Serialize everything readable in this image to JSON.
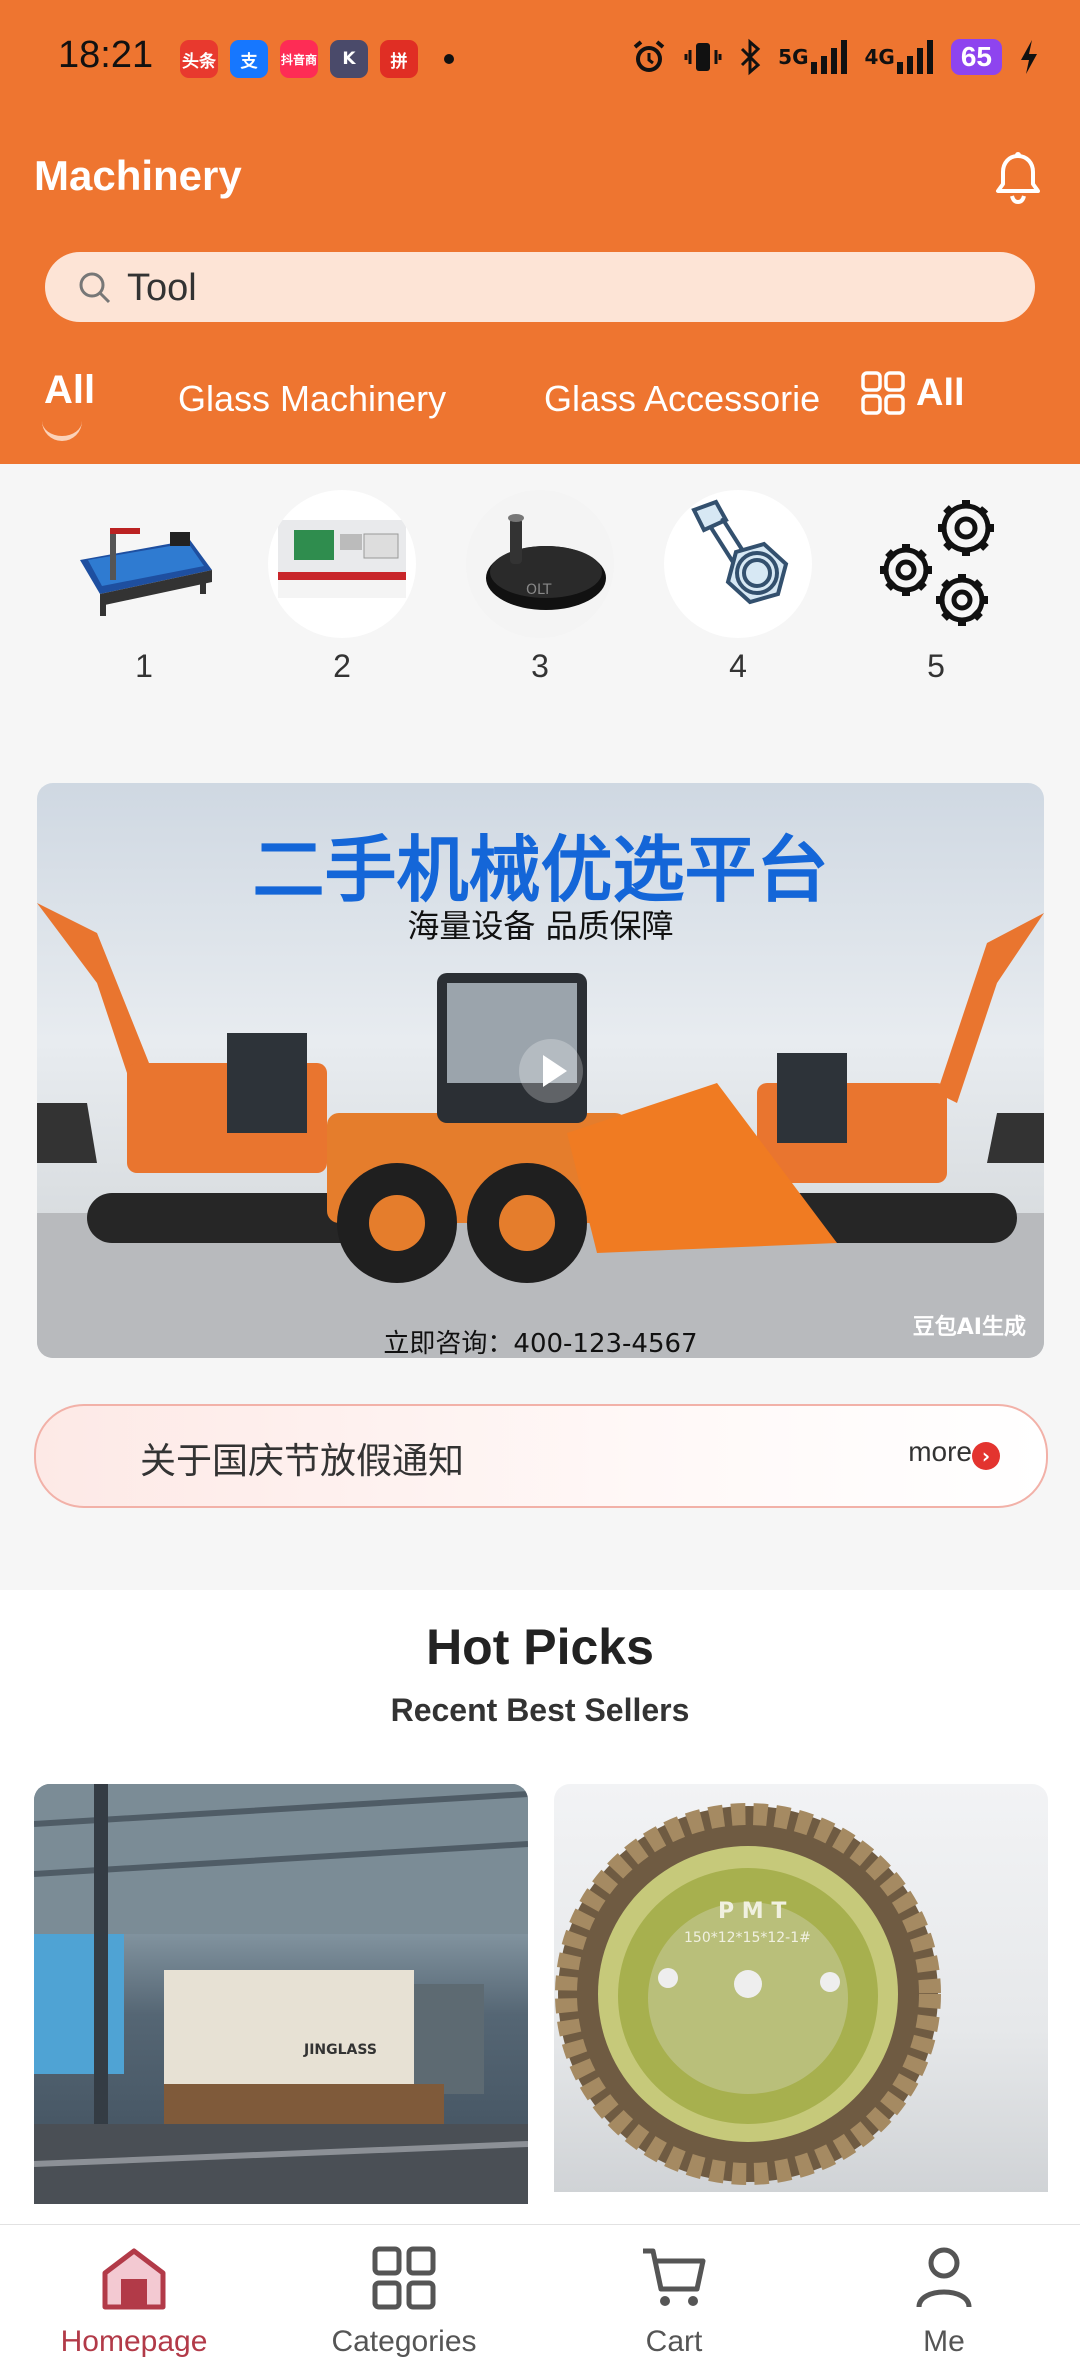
{
  "status_bar": {
    "time": "18:21",
    "app_icons": [
      {
        "name": "toutiao-app-icon",
        "label": "头条",
        "color": "#e8392e"
      },
      {
        "name": "alipay-app-icon",
        "label": "支",
        "color": "#1677ff"
      },
      {
        "name": "douyin-mall-app-icon",
        "label": "抖音商",
        "color": "#fe2c55"
      },
      {
        "name": "k-app-icon",
        "label": "K",
        "color": "#4a4a6a"
      },
      {
        "name": "pinduoduo-app-icon",
        "label": "拼",
        "color": "#e02e24"
      }
    ],
    "network": "5G",
    "network2": "4G",
    "battery": "65"
  },
  "header": {
    "title": "Machinery"
  },
  "search": {
    "value": "Tool"
  },
  "tabs": [
    {
      "label": "All",
      "active": true
    },
    {
      "label": "Glass Machinery",
      "active": false
    },
    {
      "label": "Glass Accessorie",
      "active": false
    }
  ],
  "tabs_all_label": "All",
  "categories": [
    {
      "label": "1",
      "icon": "glass-cutting-table-icon"
    },
    {
      "label": "2",
      "icon": "glass-machine-icon"
    },
    {
      "label": "3",
      "icon": "caster-wheel-icon"
    },
    {
      "label": "4",
      "icon": "bolt-nut-icon"
    },
    {
      "label": "5",
      "icon": "gears-icon"
    }
  ],
  "banner": {
    "title": "二手机械优选平台",
    "subtitle": "海量设备 品质保障",
    "contact": "立即咨询：400-123-4567",
    "watermark": "豆包AI生成"
  },
  "notice": {
    "text": "关于国庆节放假通知",
    "more": "more"
  },
  "hot_picks": {
    "title": "Hot Picks",
    "subtitle": "Recent Best Sellers",
    "products": [
      {
        "brand_text": "JINGLASS",
        "image": "glass-tempering-furnace"
      },
      {
        "brand_text": "PMT",
        "spec_text": "150*12*15*12-1#",
        "image": "diamond-grinding-wheel"
      }
    ]
  },
  "bottom_nav": [
    {
      "label": "Homepage",
      "active": true,
      "icon": "home-icon"
    },
    {
      "label": "Categories",
      "active": false,
      "icon": "categories-icon"
    },
    {
      "label": "Cart",
      "active": false,
      "icon": "cart-icon"
    },
    {
      "label": "Me",
      "active": false,
      "icon": "user-icon"
    }
  ],
  "colors": {
    "header_bg": "#ee7530",
    "search_bg": "#fde4d6",
    "accent_active": "#b23a48",
    "banner_title": "#1466d8"
  }
}
